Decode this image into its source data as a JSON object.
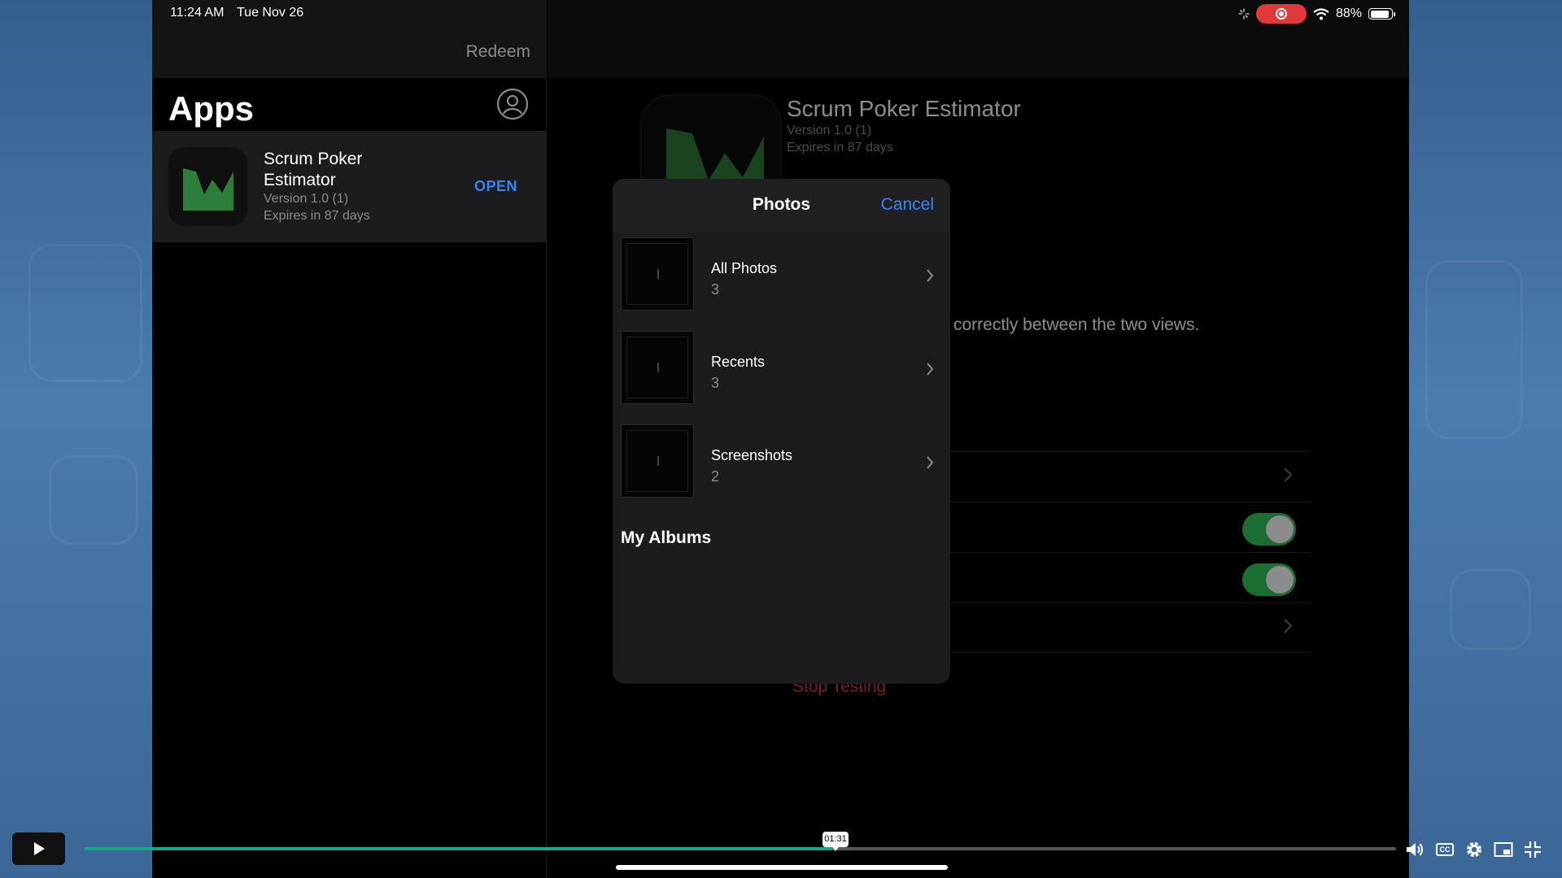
{
  "status_bar": {
    "time": "11:24 AM",
    "date": "Tue Nov 26",
    "battery": "88%",
    "battery_level": 0.88
  },
  "left_pane": {
    "redeem_label": "Redeem",
    "title": "Apps",
    "app": {
      "name": "Scrum Poker Estimator",
      "version": "Version 1.0 (1)",
      "expires": "Expires in 87 days",
      "open_label": "OPEN"
    }
  },
  "right_pane": {
    "title": "Scrum Poker Estimator",
    "version": "Version 1.0 (1)",
    "expires": "Expires in 87 days",
    "description": "w correctly between the two views.",
    "stop_testing": "Stop Testing"
  },
  "photos_sheet": {
    "title": "Photos",
    "cancel_label": "Cancel",
    "albums": [
      {
        "name": "All Photos",
        "count": "3"
      },
      {
        "name": "Recents",
        "count": "3"
      },
      {
        "name": "Screenshots",
        "count": "2"
      }
    ],
    "my_albums_label": "My Albums"
  },
  "player": {
    "current_time": "01:31",
    "progress": 0.57,
    "accent": "#1aa68a",
    "icons": [
      "play-icon",
      "volume-icon",
      "closed-captions-icon",
      "settings-gear-icon",
      "picture-in-picture-icon",
      "exit-fullscreen-icon"
    ]
  },
  "colors": {
    "link_blue": "#3a82f7",
    "toggle_green": "#34c759",
    "destructive_red": "#e0383b"
  }
}
